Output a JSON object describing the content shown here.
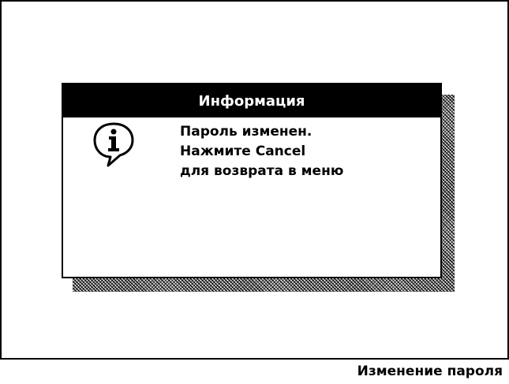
{
  "dialog": {
    "title": "Информация",
    "icon": "info-speech-bubble-icon",
    "message_lines": [
      "Пароль изменен.",
      "Нажмите Cancel",
      "для возврата в меню"
    ]
  },
  "status_bar": {
    "label": "Изменение пароля"
  }
}
